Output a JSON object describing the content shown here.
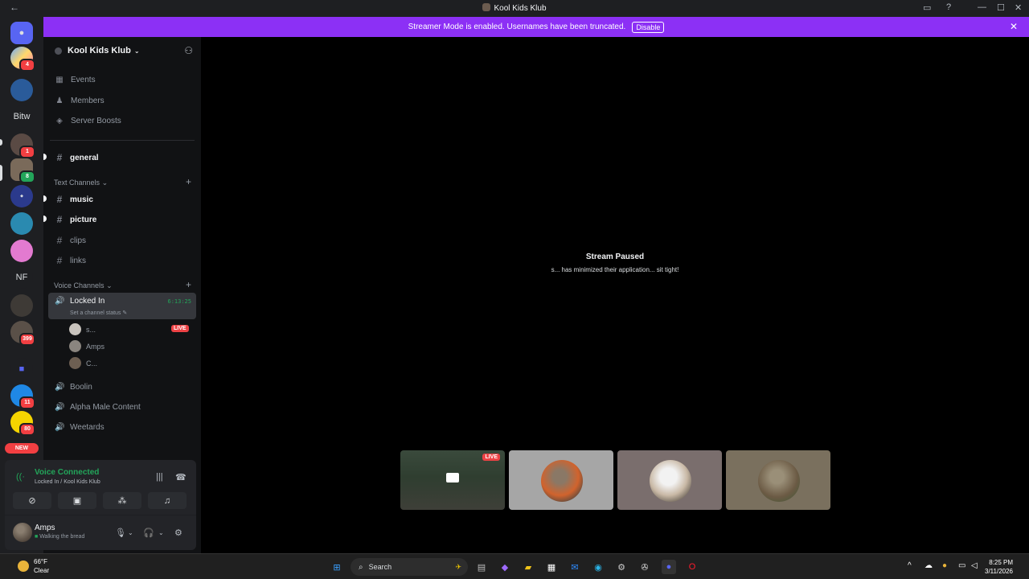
{
  "window": {
    "title": "Kool Kids Klub"
  },
  "banner": {
    "text": "Streamer Mode is enabled. Usernames have been truncated.",
    "button": "Disable"
  },
  "servers": [
    {
      "label": "",
      "badge": ""
    },
    {
      "label": "",
      "badge": "4"
    },
    {
      "label": "",
      "badge": ""
    },
    {
      "label": "Bitw",
      "badge": ""
    },
    {
      "label": "",
      "badge": "1"
    },
    {
      "label": "",
      "badge": "8"
    },
    {
      "label": "",
      "badge": ""
    },
    {
      "label": "",
      "badge": ""
    },
    {
      "label": "",
      "badge": ""
    },
    {
      "label": "NF",
      "badge": ""
    },
    {
      "label": "",
      "badge": ""
    },
    {
      "label": "",
      "badge": "399"
    },
    {
      "label": "",
      "badge": ""
    },
    {
      "label": "",
      "badge": "11"
    },
    {
      "label": "",
      "badge": "80"
    }
  ],
  "rail_new_label": "NEW",
  "guild": {
    "name": "Kool Kids Klub"
  },
  "nav": {
    "events": "Events",
    "members": "Members",
    "boosts": "Server Boosts"
  },
  "channels": {
    "general": "general",
    "text_category": "Text Channels",
    "text": [
      "music",
      "picture",
      "clips",
      "links"
    ],
    "voice_category": "Voice Channels",
    "active_voice": {
      "name": "Locked In",
      "status": "Set a channel status",
      "timer": "6:13:25"
    },
    "members": [
      {
        "name": "s...",
        "live": "LIVE"
      },
      {
        "name": "Amps",
        "live": ""
      },
      {
        "name": "C...",
        "live": ""
      }
    ],
    "voice": [
      "Boolin",
      "Alpha Male Content",
      "Weetards"
    ]
  },
  "voice_panel": {
    "title": "Voice Connected",
    "subtitle": "Locked In / Kool Kids Klub"
  },
  "user": {
    "name": "Amps",
    "status": "Walking the bread"
  },
  "stage": {
    "title": "Stream Paused",
    "subtitle": "s... has minimized their application... sit tight!",
    "tiles": [
      {
        "live": "LIVE"
      },
      {
        "live": ""
      },
      {
        "live": ""
      },
      {
        "live": ""
      }
    ]
  },
  "taskbar": {
    "temperature": "66°F",
    "condition": "Clear",
    "search": "Search",
    "time": "8:25 PM",
    "date": "3/11/2026"
  },
  "colors": {
    "brand_purple": "#8c30f5",
    "voice_green": "#23a55a",
    "live_red": "#ed4245"
  }
}
